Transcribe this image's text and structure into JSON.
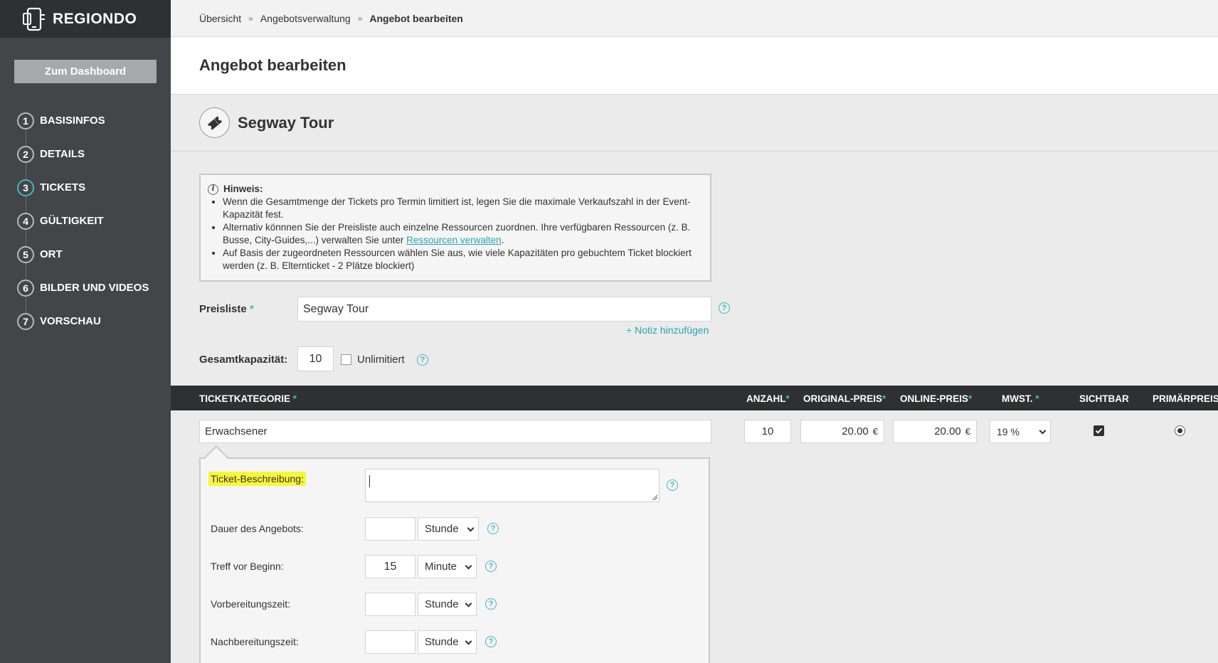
{
  "brand": {
    "name": "REGIONDO"
  },
  "sidebar": {
    "dashboard_button": "Zum Dashboard",
    "steps": [
      {
        "num": "1",
        "label": "BASISINFOS"
      },
      {
        "num": "2",
        "label": "DETAILS"
      },
      {
        "num": "3",
        "label": "TICKETS"
      },
      {
        "num": "4",
        "label": "GÜLTIGKEIT"
      },
      {
        "num": "5",
        "label": "ORT"
      },
      {
        "num": "6",
        "label": "BILDER UND VIDEOS"
      },
      {
        "num": "7",
        "label": "VORSCHAU"
      }
    ],
    "active_step": "3"
  },
  "breadcrumb": {
    "items": [
      "Übersicht",
      "Angebotsverwaltung",
      "Angebot bearbeiten"
    ],
    "separator": "»"
  },
  "page": {
    "title": "Angebot bearbeiten",
    "offer_name": "Segway Tour"
  },
  "hint": {
    "heading": "Hinweis:",
    "items": [
      "Wenn die Gesamtmenge der Tickets pro Termin limitiert ist, legen Sie die maximale Verkaufszahl in der Event-Kapazität fest.",
      "Alternativ könnnen Sie der Preisliste auch einzelne Ressourcen zuordnen. Ihre verfügbaren Ressourcen (z. B. Busse, City-Guides,...) verwalten Sie unter ",
      "Auf Basis der zugeordneten Ressourcen wählen Sie aus, wie viele Kapazitäten pro gebuchtem Ticket blockiert werden (z. B. Elternticket - 2 Plätze blockiert)"
    ],
    "link_text": "Ressourcen verwalten",
    "link_suffix": "."
  },
  "form": {
    "pricelist_label": "Preisliste",
    "pricelist_value": "Segway Tour",
    "add_note": "Notiz hinzufügen",
    "add_note_plus": "+",
    "capacity_label": "Gesamtkapazität:",
    "capacity_value": "10",
    "unlimited_label": "Unlimitiert",
    "required_mark": "*"
  },
  "ticket_table": {
    "headers": {
      "category": "TICKETKATEGORIE",
      "count": "ANZAHL",
      "original_price": "ORIGINAL-PREIS",
      "online_price": "ONLINE-PREIS",
      "vat": "MWST.",
      "visible": "SICHTBAR",
      "primary_price": "PRIMÄRPREIS"
    },
    "rows": [
      {
        "category": "Erwachsener",
        "count": "10",
        "original_price": "20.00",
        "online_price": "20.00",
        "currency": "€",
        "vat": "19 %",
        "visible": true,
        "primary": true
      }
    ]
  },
  "ticket_details": {
    "description_label": "Ticket-Beschreibung:",
    "description_value": "",
    "duration_label": "Dauer des Angebots:",
    "duration_value": "",
    "duration_unit": "Stunde",
    "meet_label": "Treff vor Beginn:",
    "meet_value": "15",
    "meet_unit": "Minute",
    "prep_label": "Vorbereitungszeit:",
    "prep_value": "",
    "prep_unit": "Stunde",
    "post_label": "Nachbereitungszeit:",
    "post_value": "",
    "post_unit": "Stunde"
  },
  "colors": {
    "accent": "#3fb7c6",
    "sidebar_bg": "#434548",
    "sidebar_dark": "#2f3033",
    "highlight": "#f7f73a"
  },
  "icons": {
    "logo": "phone-outline-logo-icon",
    "offer": "ticket-icon",
    "help": "question-circle-icon",
    "info": "info-circle-icon"
  }
}
